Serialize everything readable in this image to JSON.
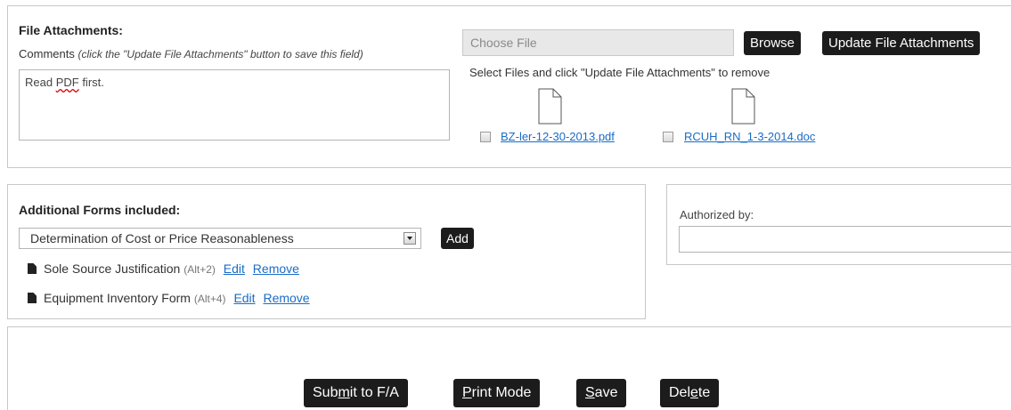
{
  "attachments": {
    "title": "File Attachments:",
    "comments_label": "Comments",
    "comments_hint": "(click the \"Update File Attachments\" button to save this field)",
    "comments_value_part1": "Read ",
    "comments_value_spell": "PDF",
    "comments_value_part2": " first.",
    "choose_file_placeholder": "Choose File",
    "browse_label": "Browse",
    "update_label": "Update File Attachments",
    "select_hint": "Select Files and click \"Update File Attachments\" to remove",
    "files": [
      {
        "name": "BZ-ler-12-30-2013.pdf",
        "checked": false
      },
      {
        "name": "RCUH_RN_1-3-2014.doc",
        "checked": false
      }
    ]
  },
  "forms": {
    "title": "Additional Forms included:",
    "selected_option": "Determination of Cost or Price Reasonableness",
    "add_label": "Add",
    "items": [
      {
        "name": "Sole Source Justification",
        "shortcut": "(Alt+2)",
        "edit": "Edit",
        "remove": "Remove"
      },
      {
        "name": "Equipment Inventory Form",
        "shortcut": "(Alt+4)",
        "edit": "Edit",
        "remove": "Remove"
      }
    ]
  },
  "authorization": {
    "label": "Authorized by:",
    "value": ""
  },
  "actions": {
    "submit_pre": "Sub",
    "submit_ul": "m",
    "submit_post": "it to F/A",
    "print_ul": "P",
    "print_post": "rint Mode",
    "save_ul": "S",
    "save_post": "ave",
    "delete_pre": "Del",
    "delete_ul": "e",
    "delete_post": "te"
  },
  "colors": {
    "button_bg": "#1c1c1c",
    "link": "#1a6cc7",
    "panel_border": "#c8c8c8"
  }
}
